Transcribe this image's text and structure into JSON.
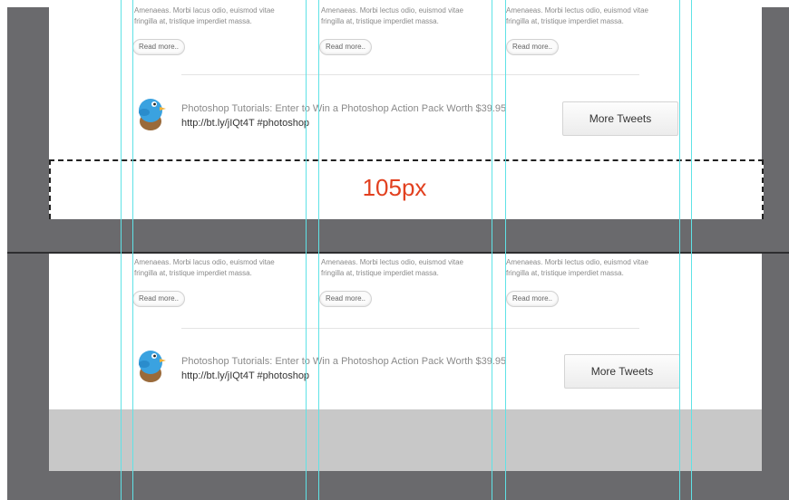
{
  "sections": [
    {
      "columns": [
        {
          "text_line1": "Amenaeas. Morbi lacus odio, euismod vitae",
          "text_line2": "fringilla at, tristique imperdiet massa.",
          "read_more": "Read more.."
        },
        {
          "text_line1": "Amenaeas. Morbi lectus odio, euismod vitae",
          "text_line2": "fringilla at, tristique imperdiet massa.",
          "read_more": "Read more.."
        },
        {
          "text_line1": "Amenaeas. Morbi lectus odio, euismod vitae",
          "text_line2": "fringilla at, tristique imperdiet massa.",
          "read_more": "Read more.."
        }
      ],
      "tweet": {
        "text": "Photoshop Tutorials: Enter to Win a Photoshop Action Pack Worth $39.95",
        "link": "http://bt.ly/jIQt4T #photoshop"
      },
      "more_tweets_label": "More Tweets"
    },
    {
      "columns": [
        {
          "text_line1": "Amenaeas. Morbi lacus odio, euismod vitae",
          "text_line2": "fringilla at, tristique imperdiet massa.",
          "read_more": "Read more.."
        },
        {
          "text_line1": "Amenaeas. Morbi lectus odio, euismod vitae",
          "text_line2": "fringilla at, tristique imperdiet massa.",
          "read_more": "Read more.."
        },
        {
          "text_line1": "Amenaeas. Morbi lectus odio, euismod vitae",
          "text_line2": "fringilla at, tristique imperdiet massa.",
          "read_more": "Read more.."
        }
      ],
      "tweet": {
        "text": "Photoshop Tutorials: Enter to Win a Photoshop Action Pack Worth $39.95",
        "link": "http://bt.ly/jIQt4T #photoshop"
      },
      "more_tweets_label": "More Tweets"
    }
  ],
  "measurement_label": "105px",
  "colors": {
    "guide": "#5fe2e6",
    "measurement": "#e2401f",
    "background_gray": "#6a6a6d"
  },
  "icons": {
    "bird": "twitter-bird-icon"
  }
}
